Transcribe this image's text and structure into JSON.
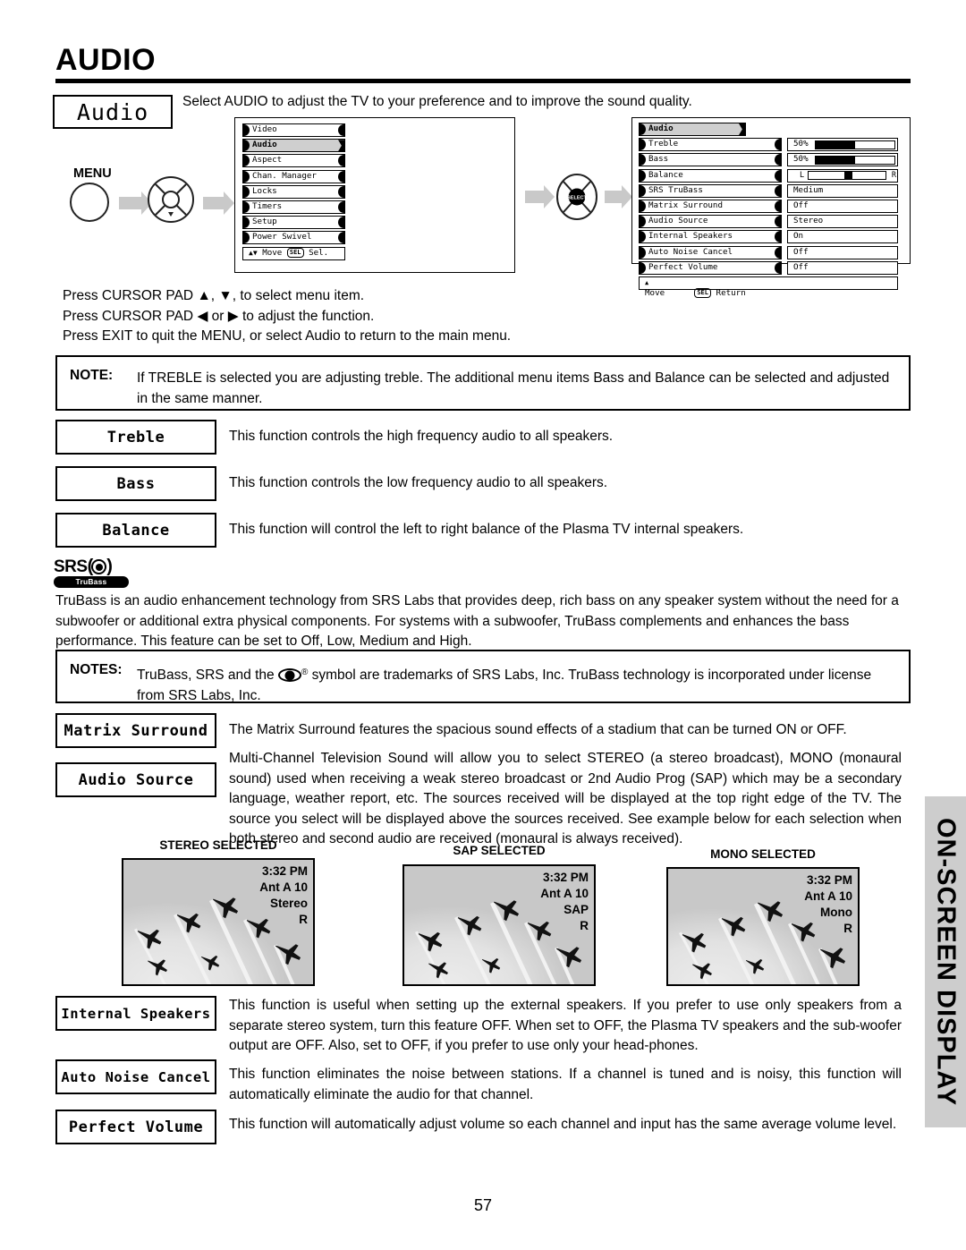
{
  "page": {
    "title": "AUDIO",
    "number": "57",
    "side_tab": "ON-SCREEN DISPLAY"
  },
  "header": {
    "label_box": "Audio",
    "intro": "Select AUDIO to adjust the TV to your preference and to improve the sound quality."
  },
  "remote": {
    "menu_label": "MENU",
    "select_label": "SELECT"
  },
  "main_menu": {
    "items": [
      {
        "label": "Video",
        "selected": false
      },
      {
        "label": "Audio",
        "selected": true
      },
      {
        "label": "Aspect",
        "selected": false
      },
      {
        "label": "Chan. Manager",
        "selected": false
      },
      {
        "label": "Locks",
        "selected": false
      },
      {
        "label": "Timers",
        "selected": false
      },
      {
        "label": "Setup",
        "selected": false
      },
      {
        "label": "Power Swivel",
        "selected": false
      }
    ],
    "footer_move": "Move",
    "footer_key": "SEL",
    "footer_action": "Sel."
  },
  "audio_menu": {
    "header": "Audio",
    "rows": [
      {
        "label": "Treble",
        "value": "50%",
        "type": "bar",
        "percent": 50
      },
      {
        "label": "Bass",
        "value": "50%",
        "type": "bar",
        "percent": 50
      },
      {
        "label": "Balance",
        "value": "",
        "type": "balance",
        "percent": 50,
        "left": "L",
        "right": "R"
      },
      {
        "label": "SRS TruBass",
        "value": "Medium",
        "type": "text"
      },
      {
        "label": "Matrix Surround",
        "value": "Off",
        "type": "text"
      },
      {
        "label": "Audio Source",
        "value": "Stereo",
        "type": "text"
      },
      {
        "label": "Internal Speakers",
        "value": "On",
        "type": "text"
      },
      {
        "label": "Auto Noise Cancel",
        "value": "Off",
        "type": "text"
      },
      {
        "label": "Perfect Volume",
        "value": "Off",
        "type": "text"
      }
    ],
    "footer_move": "Move",
    "footer_key": "SEL",
    "footer_action": "Return"
  },
  "instructions": {
    "line1_a": "Press CURSOR PAD ",
    "line1_up": "▲",
    "line1_b": ", ",
    "line1_dn": "▼",
    "line1_c": ", to select menu item.",
    "line2_a": "Press CURSOR PAD  ",
    "line2_left": "◀",
    "line2_b": " or ",
    "line2_right": "▶",
    "line2_c": " to adjust the function.",
    "line3": "Press EXIT to quit the MENU, or select Audio to return to the main menu."
  },
  "note_treble": {
    "label": "NOTE:",
    "body": "If TREBLE is selected you are adjusting treble.  The additional menu items Bass and Balance can be selected and adjusted in the same manner."
  },
  "functions": {
    "treble": {
      "name": "Treble",
      "desc": "This function controls the high frequency audio to all speakers."
    },
    "bass": {
      "name": "Bass",
      "desc": "This function controls the low frequency audio to all speakers."
    },
    "balance": {
      "name": "Balance",
      "desc": "This function will control the left to right balance of the Plasma TV internal speakers."
    },
    "matrix": {
      "name": "Matrix Surround",
      "desc": "The Matrix Surround features the spacious sound effects of a stadium that can be turned ON or OFF."
    },
    "audio_source": {
      "name": "Audio Source",
      "desc": "Multi-Channel Television Sound will allow you to select STEREO (a stereo broadcast), MONO (monaural sound) used when receiving a weak stereo broadcast or 2nd Audio Prog (SAP) which may be a secondary language, weather report, etc. The sources received will be displayed at the top right edge of the TV.  The source you select will be displayed above the sources received.  See example below for each selection when both stereo and second audio are received (monaural is always received)."
    },
    "internal_speakers": {
      "name": "Internal Speakers",
      "desc": "This function is useful when setting up the external speakers.  If you prefer to use only speakers from a separate stereo system, turn this feature OFF.  When set to OFF, the Plasma TV speakers and the sub-woofer output are OFF.  Also, set to OFF, if you prefer to use only your head-phones."
    },
    "auto_noise_cancel": {
      "name": "Auto Noise Cancel",
      "desc": "This function eliminates the noise between stations. If a channel is tuned and is noisy, this function will automatically eliminate the audio for that channel."
    },
    "perfect_volume": {
      "name": "Perfect Volume",
      "desc": "This function will automatically adjust volume so each channel  and input has the same average volume level."
    }
  },
  "srs": {
    "brand": "SRS",
    "sub": "TruBass",
    "paragraph": "TruBass is an audio enhancement technology from SRS Labs that provides deep, rich bass on any speaker system without the need for a subwoofer or additional extra physical components.  For systems with a subwoofer, TruBass complements and enhances the bass performance.  This feature can be set to Off, Low, Medium and High.",
    "notes_label": "NOTES:",
    "notes_a": "TruBass, SRS and the",
    "notes_reg": "®",
    "notes_b": "symbol are trademarks of SRS Labs, Inc.  TruBass technology is incorporated under license from SRS Labs, Inc."
  },
  "examples": [
    {
      "title": "STEREO SELECTED",
      "time": "3:32 PM",
      "channel": "Ant A 10",
      "mode": "Stereo",
      "audio": "R"
    },
    {
      "title": "SAP SELECTED",
      "time": "3:32 PM",
      "channel": "Ant A 10",
      "mode": "SAP",
      "audio": "R"
    },
    {
      "title": "MONO SELECTED",
      "time": "3:32 PM",
      "channel": "Ant A 10",
      "mode": "Mono",
      "audio": "R"
    }
  ],
  "colors": {
    "side_tab_bg": "#cdcdcd",
    "osd_selected_bg": "#cfcfcf",
    "arrow": "#c9c9c9",
    "tv_bg": "#c8c8c8"
  }
}
